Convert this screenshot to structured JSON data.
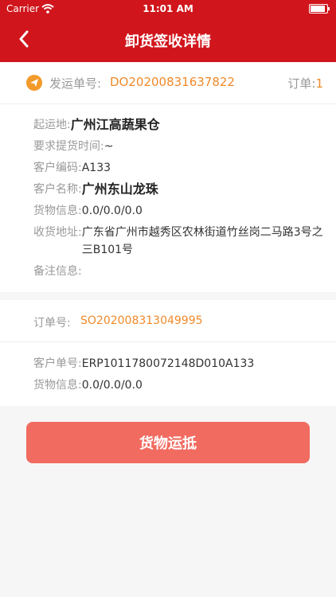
{
  "status_bar": {
    "carrier": "Carrier",
    "time": "11:01 AM"
  },
  "nav": {
    "title": "卸货签收详情"
  },
  "shipment": {
    "label": "发运单号:",
    "number": "DO20200831637822",
    "order_label": "订单:",
    "order_count": "1"
  },
  "details": {
    "origin_label": "起运地:",
    "origin_value": "广州江高蔬果仓",
    "pickup_time_label": "要求提货时间:",
    "pickup_time_value": "~",
    "customer_code_label": "客户编码:",
    "customer_code_value": "A133",
    "customer_name_label": "客户名称:",
    "customer_name_value": "广州东山龙珠",
    "cargo_label": "货物信息:",
    "cargo_value": "0.0/0.0/0.0",
    "address_label": "收货地址:",
    "address_value": "广东省广州市越秀区农林街道竹丝岗二马路3号之三B101号",
    "remark_label": "备注信息:",
    "remark_value": ""
  },
  "order": {
    "label": "订单号:",
    "number": "SO202008313049995",
    "customer_order_label": "客户单号:",
    "customer_order_value": "ERP1011780072148D010A133",
    "cargo_label": "货物信息:",
    "cargo_value": "0.0/0.0/0.0"
  },
  "action": {
    "label": "货物运抵"
  },
  "colors": {
    "brand": "#d0161c",
    "accent": "#f08a2a",
    "button": "#f16b60"
  }
}
